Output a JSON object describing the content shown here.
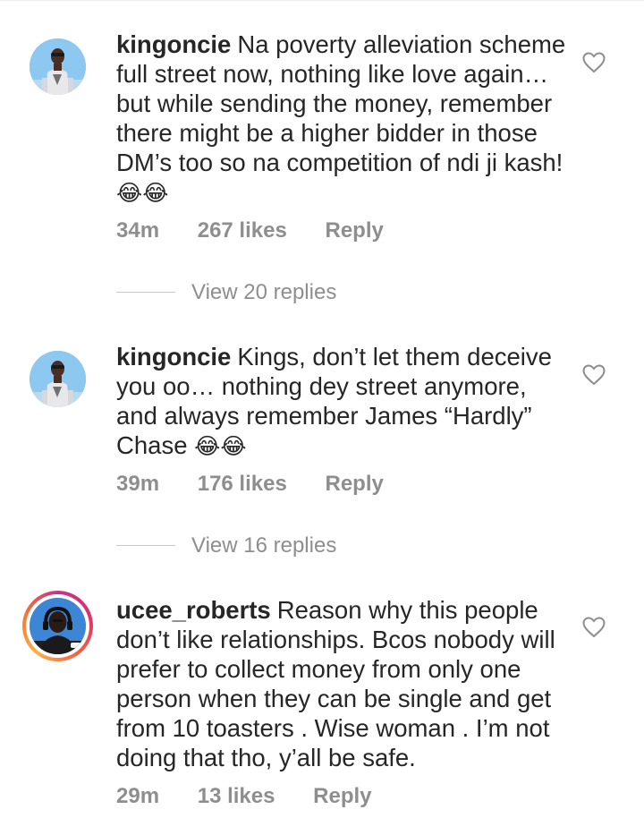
{
  "comments": [
    {
      "username": "kingoncie",
      "text": "Na poverty alleviation scheme full street now, nothing like love again… but while sending the money, remember there might be a higher bidder in those DM’s too so na competition of ndi ji kash! ",
      "emoji": "😂😂",
      "time": "34m",
      "likes": "267 likes",
      "reply": "Reply",
      "view_replies": "View 20 replies"
    },
    {
      "username": "kingoncie",
      "text": "Kings, don’t let them deceive you oo… nothing dey street anymore, and always remember James “Hardly” Chase ",
      "emoji": "😂😂",
      "time": "39m",
      "likes": "176 likes",
      "reply": "Reply",
      "view_replies": "View 16 replies"
    },
    {
      "username": "ucee_roberts",
      "text": "Reason why this people don’t like relationships. Bcos nobody will prefer to collect money from only one person when they can be single and get from 10 toasters . Wise woman . I’m not doing that tho, y’all be safe.",
      "emoji": "",
      "time": "29m",
      "likes": "13 likes",
      "reply": "Reply"
    }
  ],
  "icons": {
    "like": "heart-outline-icon"
  },
  "colors": {
    "text": "#262626",
    "meta": "#8e8e8e",
    "story_ring": "#e1306c"
  }
}
